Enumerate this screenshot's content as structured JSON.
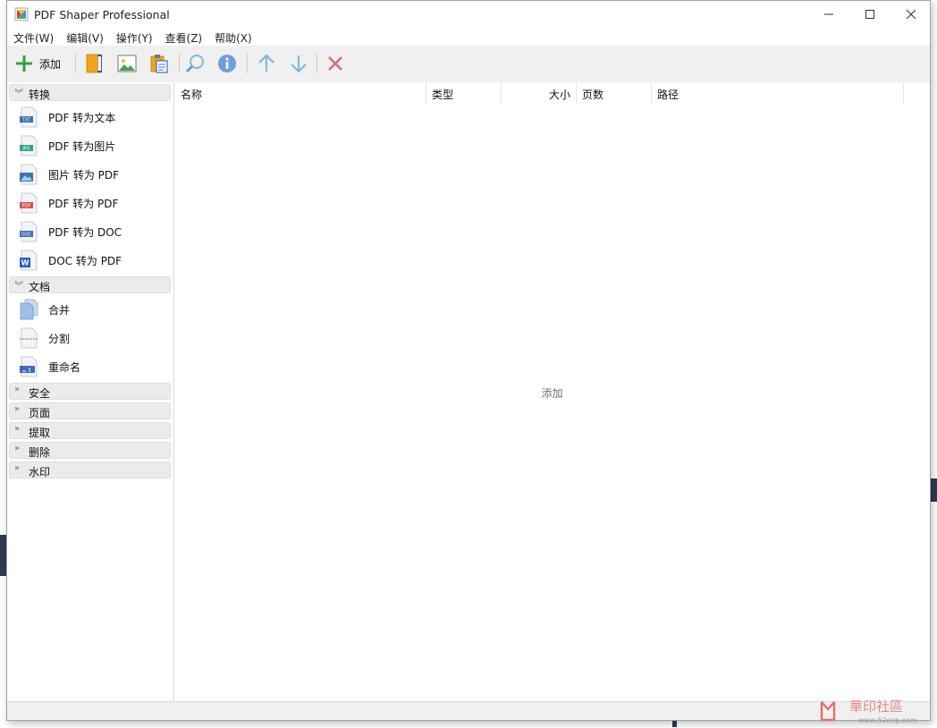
{
  "window": {
    "title": "PDF Shaper Professional",
    "controls": {
      "minimize": "minimize",
      "maximize": "maximize",
      "close": "close"
    }
  },
  "menu": [
    {
      "label": "文件(W)"
    },
    {
      "label": "编辑(V)"
    },
    {
      "label": "操作(Y)"
    },
    {
      "label": "查看(Z)"
    },
    {
      "label": "帮助(X)"
    }
  ],
  "toolbar": {
    "add_label": "添加",
    "icons": [
      "plus-icon",
      "book-icon",
      "image-icon",
      "clipboard-icon",
      "search-icon",
      "info-icon",
      "arrow-up-icon",
      "arrow-down-icon",
      "delete-x-icon"
    ],
    "colors": {
      "add": "#2e9e47",
      "arrow": "#7fb8df",
      "delete": "#e06a6a",
      "info": "#6f9fd8"
    }
  },
  "sidebar": {
    "convert": {
      "header": "转换",
      "items": [
        {
          "label": "PDF 转为文本",
          "badge": "TXT",
          "badge_color": "#3c6fb4"
        },
        {
          "label": "PDF 转为图片",
          "badge": "JPG",
          "badge_color": "#2ba58a"
        },
        {
          "label": "图片 转为 PDF",
          "badge": "",
          "badge_color": "#3c6fb4"
        },
        {
          "label": "PDF 转为 PDF",
          "badge": "PDF",
          "badge_color": "#d9534f"
        },
        {
          "label": "PDF 转为 DOC",
          "badge": "DOC",
          "badge_color": "#3c6fb4"
        },
        {
          "label": "DOC 转为 PDF",
          "badge": "W",
          "badge_color": "#2b62b8"
        }
      ]
    },
    "document": {
      "header": "文档",
      "items": [
        {
          "label": "合并"
        },
        {
          "label": "分割"
        },
        {
          "label": "重命名"
        }
      ]
    },
    "collapsed": [
      {
        "label": "安全"
      },
      {
        "label": "页面"
      },
      {
        "label": "提取"
      },
      {
        "label": "删除"
      },
      {
        "label": "水印"
      }
    ]
  },
  "file_list": {
    "columns": [
      {
        "label": "名称"
      },
      {
        "label": "类型"
      },
      {
        "label": "大小"
      },
      {
        "label": "页数"
      },
      {
        "label": "路径"
      }
    ],
    "empty_hint": "添加"
  },
  "watermark": {
    "main": "華印社區",
    "url": "www.52cnp.com"
  }
}
